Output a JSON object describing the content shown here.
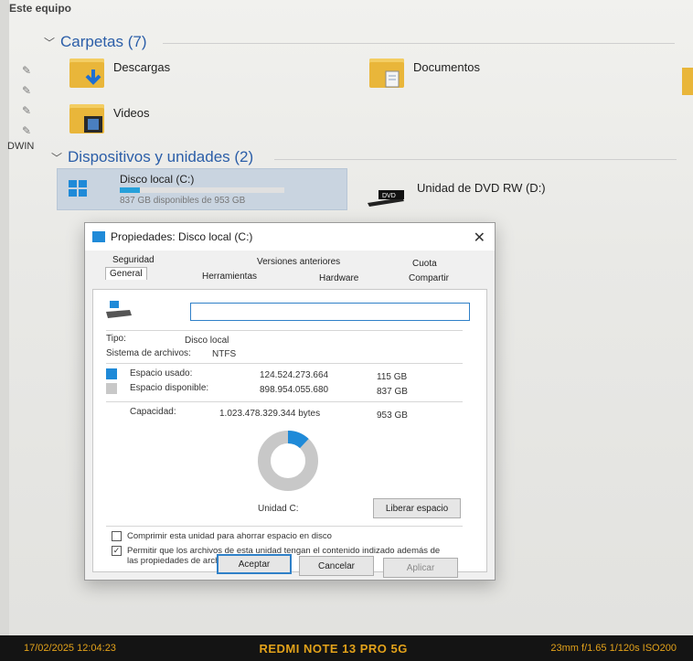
{
  "explorer": {
    "breadcrumb": "Este equipo",
    "sidebar_label": "DWIN",
    "folders_group": "Carpetas (7)",
    "folders": [
      {
        "name": "Descargas",
        "icon": "download-arrow-icon"
      },
      {
        "name": "Documentos",
        "icon": "document-icon"
      },
      {
        "name": "Videos",
        "icon": "film-icon"
      }
    ],
    "devices_group": "Dispositivos y unidades (2)",
    "drive": {
      "name": "Disco local (C:)",
      "free_text": "837 GB disponibles de 953 GB",
      "used_fraction": 0.12
    },
    "dvd": {
      "badge": "DVD",
      "name": "Unidad de DVD RW (D:)"
    }
  },
  "dialog": {
    "title": "Propiedades: Disco local (C:)",
    "close_glyph": "✕",
    "tabs_row1": [
      "Seguridad",
      "Versiones anteriores",
      "Cuota"
    ],
    "tabs_row2": [
      "General",
      "Herramientas",
      "Hardware",
      "Compartir"
    ],
    "name_value": "",
    "type_label": "Tipo:",
    "type_value": "Disco local",
    "fs_label": "Sistema de archivos:",
    "fs_value": "NTFS",
    "used_label": "Espacio usado:",
    "used_bytes": "124.524.273.664",
    "used_gb": "115 GB",
    "free_label": "Espacio disponible:",
    "free_bytes": "898.954.055.680",
    "free_gb": "837 GB",
    "capacity_label": "Capacidad:",
    "capacity_bytes": "1.023.478.329.344 bytes",
    "capacity_gb": "953 GB",
    "used_fraction": 0.12,
    "drive_caption": "Unidad C:",
    "cleanup_button": "Liberar espacio",
    "compress_label": "Comprimir esta unidad para ahorrar espacio en disco",
    "index_label": "Permitir que los archivos de esta unidad tengan el contenido indizado además de las propiedades de archivo",
    "ok_button": "Aceptar",
    "cancel_button": "Cancelar",
    "apply_button": "Aplicar",
    "colors": {
      "used": "#1f8ad8",
      "free": "#c8c8c8",
      "accent": "#2f80c8"
    }
  },
  "camera_overlay": {
    "datetime": "17/02/2025 12:04:23",
    "model": "REDMI NOTE 13 PRO 5G",
    "exposure": "23mm f/1.65 1/120s ISO200"
  }
}
